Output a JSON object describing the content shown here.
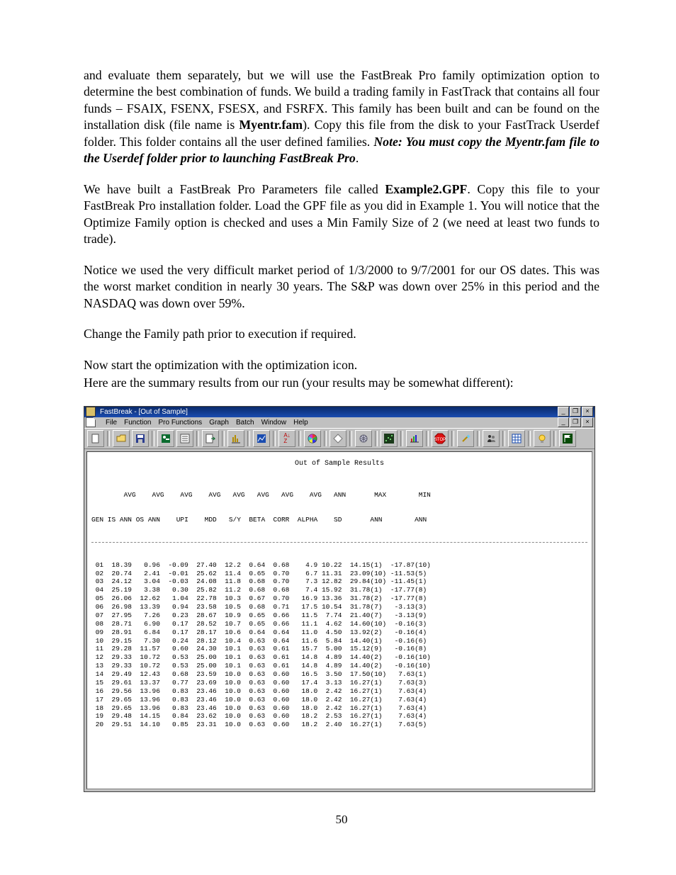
{
  "page_number": "50",
  "para1_a": "and evaluate them separately, but we will use the FastBreak Pro family optimization option to determine the best combination of funds.  We build a trading family in FastTrack that contains all four funds – FSAIX, FSENX, FSESX, and FSRFX.  This family has been built and can be found on the installation disk (file name is ",
  "para1_b": "Myentr.fam",
  "para1_c": "). Copy this file from the disk to your FastTrack Userdef folder.  This folder contains all the user defined families.  ",
  "para1_note": "Note:  You must copy the Myentr.fam file to the Userdef folder prior to launching FastBreak Pro",
  "para1_d": ".",
  "para2_a": "We have built a FastBreak Pro Parameters file called ",
  "para2_b": "Example2.GPF",
  "para2_c": ".  Copy this file to your FastBreak Pro installation folder.  Load the GPF file as you did in Example 1.  You will notice that the Optimize Family option is checked and uses a Min Family Size of 2 (we need at least two funds to trade).",
  "para3": "Notice we used the very difficult market period of 1/3/2000 to 9/7/2001 for our OS dates.  This was the worst market condition in nearly 30 years.  The S&P was down over 25% in this period and the NASDAQ was down over 59%.",
  "para4": "Change the Family path prior to execution if required.",
  "para5": "Now start the optimization with the optimization icon.",
  "para6": "Here are the summary results from our run (your results may be somewhat different):",
  "app": {
    "title": "FastBreak - [Out of Sample]",
    "menus": [
      "File",
      "Function",
      "Pro Functions",
      "Graph",
      "Batch",
      "Window",
      "Help"
    ],
    "caption": "Out of Sample Results",
    "hdr1": "        AVG    AVG    AVG    AVG   AVG   AVG   AVG    AVG   ANN       MAX        MIN",
    "hdr2": "GEN IS ANN OS ANN    UPI    MDD   S/Y  BETA  CORR  ALPHA    SD       ANN        ANN",
    "rows": [
      " 01  18.39   0.96  -0.09  27.40  12.2  0.64  0.68    4.9 10.22  14.15(1)  -17.87(10)",
      " 02  20.74   2.41  -0.01  25.62  11.4  0.65  0.70    6.7 11.31  23.09(10) -11.53(5)",
      " 03  24.12   3.04  -0.03  24.08  11.8  0.68  0.70    7.3 12.82  29.84(10) -11.45(1)",
      " 04  25.19   3.38   0.30  25.82  11.2  0.68  0.68    7.4 15.92  31.78(1)  -17.77(8)",
      " 05  26.06  12.62   1.04  22.78  10.3  0.67  0.70   16.9 13.36  31.78(2)  -17.77(8)",
      " 06  26.98  13.39   0.94  23.58  10.5  0.68  0.71   17.5 10.54  31.78(7)   -3.13(3)",
      " 07  27.95   7.26   0.23  28.67  10.9  0.65  0.66   11.5  7.74  21.40(7)   -3.13(9)",
      " 08  28.71   6.90   0.17  28.52  10.7  0.65  0.66   11.1  4.62  14.60(10)  -0.16(3)",
      " 09  28.91   6.84   0.17  28.17  10.6  0.64  0.64   11.0  4.50  13.92(2)   -0.16(4)",
      " 10  29.15   7.30   0.24  28.12  10.4  0.63  0.64   11.6  5.84  14.40(1)   -0.16(6)",
      " 11  29.28  11.57   0.60  24.30  10.1  0.63  0.61   15.7  5.00  15.12(9)   -0.16(8)",
      " 12  29.33  10.72   0.53  25.00  10.1  0.63  0.61   14.8  4.89  14.40(2)   -0.16(10)",
      " 13  29.33  10.72   0.53  25.00  10.1  0.63  0.61   14.8  4.89  14.40(2)   -0.16(10)",
      " 14  29.49  12.43   0.68  23.59  10.0  0.63  0.60   16.5  3.50  17.50(10)   7.63(1)",
      " 15  29.61  13.37   0.77  23.69  10.0  0.63  0.60   17.4  3.13  16.27(1)    7.63(3)",
      " 16  29.56  13.96   0.83  23.46  10.0  0.63  0.60   18.0  2.42  16.27(1)    7.63(4)",
      " 17  29.65  13.96   0.83  23.46  10.0  0.63  0.60   18.0  2.42  16.27(1)    7.63(4)",
      " 18  29.65  13.96   0.83  23.46  10.0  0.63  0.60   18.0  2.42  16.27(1)    7.63(4)",
      " 19  29.48  14.15   0.84  23.62  10.0  0.63  0.60   18.2  2.53  16.27(1)    7.63(4)",
      " 20  29.51  14.10   0.85  23.31  10.0  0.63  0.60   18.2  2.40  16.27(1)    7.63(5)"
    ]
  },
  "toolbar_icons": [
    "doc-blank-icon",
    "folder-open-icon",
    "save-icon",
    "tools-icon",
    "forms-icon",
    "export-icon",
    "optimize-icon",
    "chart-blue-icon",
    "sort-az-icon",
    "color-wheel-icon",
    "diamond-icon",
    "globe-gear-icon",
    "scatter-icon",
    "bar-chart-icon",
    "stop-icon",
    "wand-icon",
    "people-icon",
    "grid-icon",
    "lightbulb-icon",
    "flag-icon"
  ],
  "win_buttons": {
    "min": "_",
    "max": "❐",
    "close": "×"
  }
}
